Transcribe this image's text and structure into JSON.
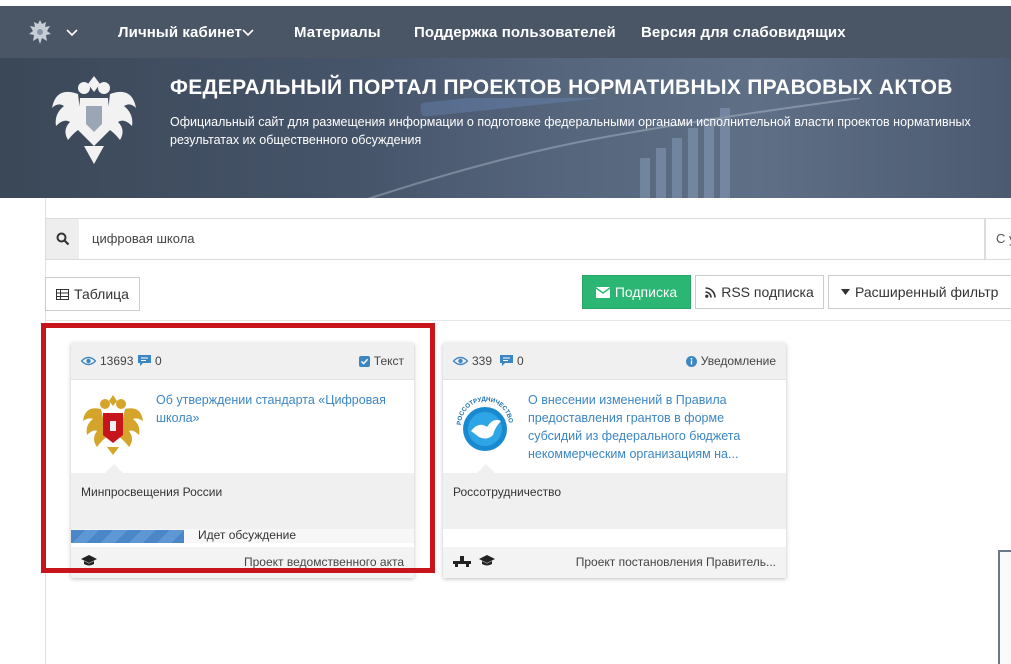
{
  "nav": {
    "items": [
      "Личный кабинет",
      "Материалы",
      "Поддержка пользователей",
      "Версия для слабовидящих"
    ]
  },
  "banner": {
    "title": "ФЕДЕРАЛЬНЫЙ ПОРТАЛ ПРОЕКТОВ НОРМАТИВНЫХ ПРАВОВЫХ АКТОВ",
    "subtitle_line1": "Официальный сайт для размещения информации о подготовке федеральными органами исполнительной власти проектов нормативных",
    "subtitle_line2": "результатах их общественного обсуждения"
  },
  "search": {
    "value": "цифровая школа",
    "side_text": "С у"
  },
  "toolbar": {
    "table_label": "Таблица",
    "subscribe_label": "Подписка",
    "rss_label": "RSS подписка",
    "filter_label": "Расширенный фильтр"
  },
  "cards": [
    {
      "views": "13693",
      "comments": "0",
      "type": "Текст",
      "title": "Об утверждении стандарта «Цифровая школа»",
      "org": "Минпросвещения России",
      "status": "Идет обсуждение",
      "progress": 0.33,
      "kind": "Проект ведомственного акта"
    },
    {
      "views": "339",
      "comments": "0",
      "type": "Уведомление",
      "title": "О внесении изменений в Правила предоставления грантов в форме субсидий из федерального бюджета некоммерческим организациям на...",
      "org": "Россотрудничество",
      "logo_text": "РОССОТРУДНИЧЕСТВО",
      "kind": "Проект постановления Правитель..."
    }
  ],
  "colors": {
    "nav_bg": "#4a5666",
    "subscribe_green": "#2bb673",
    "link_blue": "#3c86c4",
    "highlight_red": "#c8151b"
  }
}
